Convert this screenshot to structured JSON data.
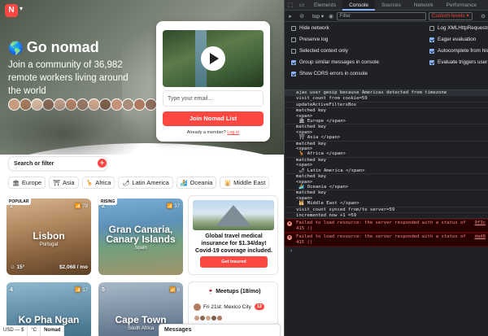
{
  "site": {
    "logo_text": "N",
    "hero_title": "Go nomad",
    "hero_subtitle": "Join a community of 36,982 remote workers living around the world",
    "avatar_colors": [
      "#c79c7f",
      "#a57a5c",
      "#d9b8a0",
      "#8a6a57",
      "#c2a08a",
      "#b8876c",
      "#9c7b68",
      "#d1a88e",
      "#7d5e4c",
      "#c4917a",
      "#a88d7a",
      "#b07a60",
      "#8f6f5f",
      "#cfae95"
    ],
    "email_placeholder": "Type your email...",
    "join_button": "Join Nomad List",
    "member_text": "Already a member?",
    "login_link": "Log in",
    "search_label": "Search or filter",
    "regions": [
      {
        "icon": "🏛",
        "label": "Europe"
      },
      {
        "icon": "⛩",
        "label": "Asia"
      },
      {
        "icon": "🦒",
        "label": "Africa"
      },
      {
        "icon": "🌶",
        "label": "Latin America"
      },
      {
        "icon": "🏄",
        "label": "Oceania"
      },
      {
        "icon": "🕌",
        "label": "Middle East"
      }
    ],
    "cards": [
      {
        "badge": "POPULAR",
        "num": "1",
        "wifi": "📶 78",
        "name": "Lisbon",
        "country": "Portugal",
        "temp": "☺ 15°",
        "price": "$2,068 / mo"
      },
      {
        "badge": "RISING",
        "num": "2",
        "wifi": "📶 37",
        "name": "Gran Canaria, Canary Islands",
        "country": "Spain",
        "temp": "",
        "price": ""
      },
      {
        "badge": "",
        "num": "4",
        "wifi": "📶 17",
        "name": "Ko Pha Ngan",
        "country": "Thailand",
        "temp": "",
        "price": ""
      },
      {
        "badge": "",
        "num": "5",
        "wifi": "📶 6",
        "name": "Cape Town",
        "country": "South Africa",
        "temp": "",
        "price": ""
      }
    ],
    "ad": {
      "text": "Global travel medical insurance for $1.34/day! Covid-19 coverage included.",
      "button": "Get insured"
    },
    "meetups": {
      "title": "🍷 Meetups (18/mo)",
      "item": "Fri 21st: Mexico City",
      "count": "12"
    },
    "bottom_bar": [
      "USD — $",
      "°C",
      "Nomad"
    ],
    "messages": "Messages"
  },
  "devtools": {
    "tabs": [
      "Elements",
      "Console",
      "Sources",
      "Network",
      "Performance"
    ],
    "active_tab": "Console",
    "context": "top ▾",
    "filter_placeholder": "Filter",
    "levels": "Custom levels ▾",
    "options_left": [
      "Hide network",
      "Preserve log",
      "Selected context only",
      "Group similar messages in console",
      "Show CORS errors in console"
    ],
    "options_left_checked": [
      false,
      false,
      false,
      true,
      true
    ],
    "options_right": [
      "Log XMLHttpRequests",
      "Eager evaluation",
      "Autocomplete from history",
      "Evaluate triggers user activation"
    ],
    "options_right_checked": [
      false,
      true,
      true,
      true
    ],
    "log_lines": [
      "ajax user geoip because Americas detected from timezone",
      "visit_count from cookie=59",
      "updateActiveFiltersBox",
      "matched key\n<span>\n 🏛 Europe </span>",
      "matched key\n<span>\n ⛩ Asia </span>",
      "matched key\n<span>\n 🦒 Africa </span>",
      "matched key\n<span>\n 🌶 Latin America </span>",
      "matched key\n<span>\n 🏄 Oceania </span>",
      "matched key\n<span>\n 🕌 Middle East </span>",
      "visit_count synced from/to server=59",
      "incremented now +1 =59"
    ],
    "errors": [
      {
        "text": "Failed to load resource: the server responded with a status of\n415 ()",
        "src": "9f3c"
      },
      {
        "text": "Failed to load resource: the server responded with a status of\n415 ()",
        "src": "dad8"
      }
    ],
    "prompt": "›"
  }
}
